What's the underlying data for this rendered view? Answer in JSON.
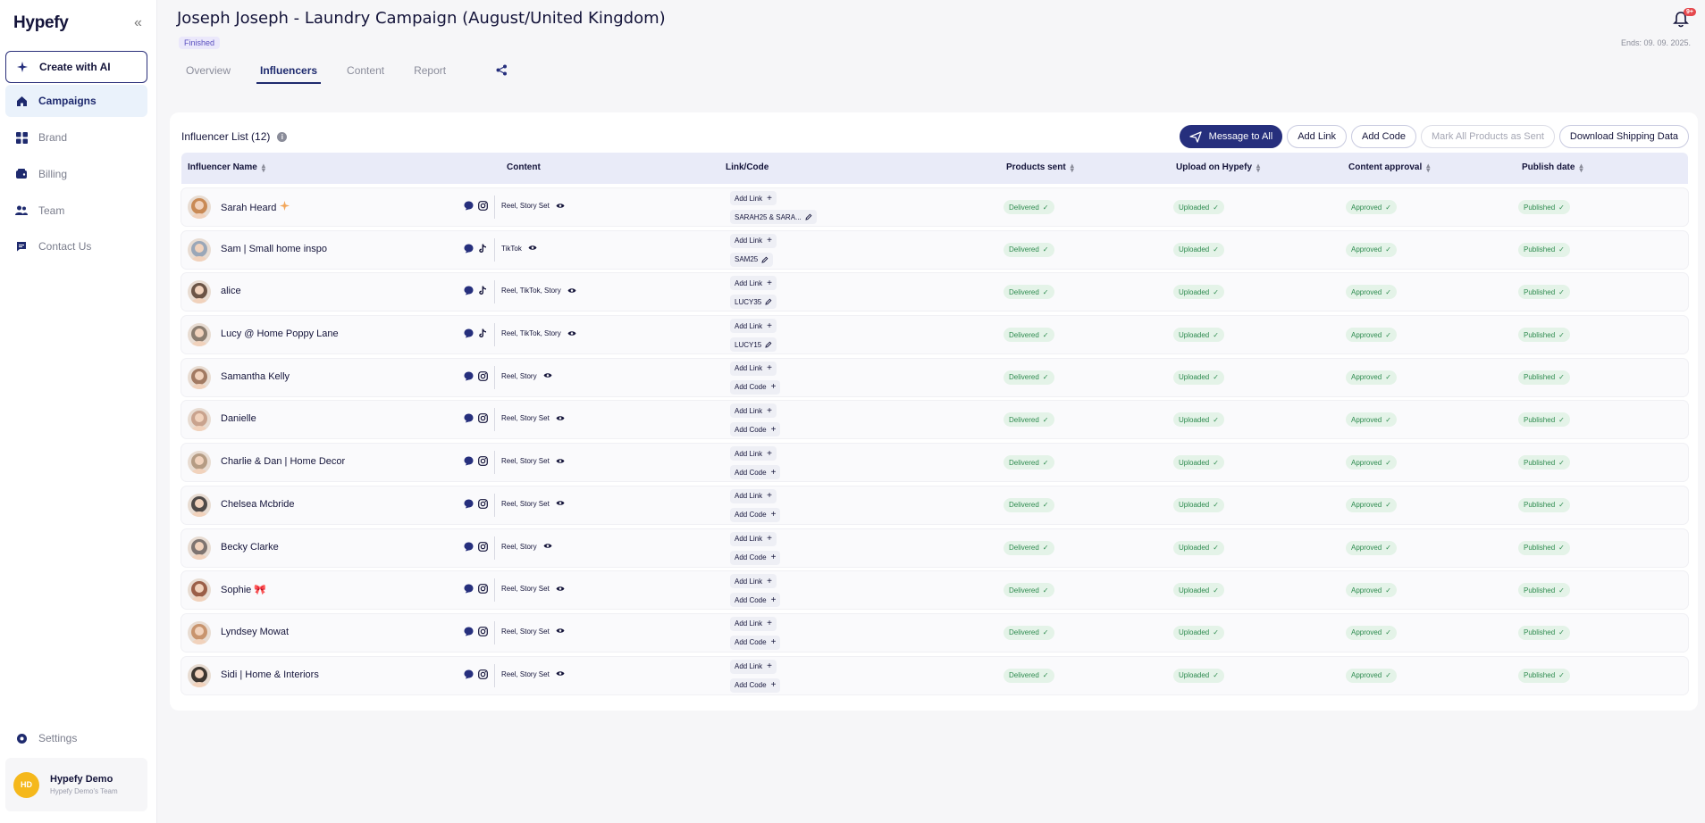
{
  "sidebar": {
    "logo": "Hypefy",
    "collapse_icon": "double-chevron-left-icon",
    "items": [
      {
        "label": "Create with AI",
        "icon": "sparkle-icon"
      },
      {
        "label": "Campaigns",
        "icon": "home-icon"
      },
      {
        "label": "Brand",
        "icon": "grid-icon"
      },
      {
        "label": "Billing",
        "icon": "wallet-icon"
      },
      {
        "label": "Team",
        "icon": "team-icon"
      },
      {
        "label": "Contact Us",
        "icon": "chat-icon"
      }
    ],
    "settings": {
      "label": "Settings",
      "icon": "gear-icon"
    },
    "user": {
      "initials": "HD",
      "name": "Hypefy Demo",
      "team": "Hypefy Demo's Team"
    }
  },
  "header": {
    "title": "Joseph Joseph - Laundry Campaign (August/United Kingdom)",
    "status": "Finished",
    "ends": "Ends: 09. 09. 2025.",
    "notification_badge": "9+",
    "tabs": [
      {
        "label": "Overview"
      },
      {
        "label": "Influencers"
      },
      {
        "label": "Content"
      },
      {
        "label": "Report"
      }
    ]
  },
  "list": {
    "title": "Influencer List (12)",
    "actions": {
      "message_all": "Message to All",
      "add_link": "Add Link",
      "add_code": "Add Code",
      "mark_sent": "Mark All Products as Sent",
      "download": "Download Shipping Data"
    },
    "columns": {
      "name": "Influencer Name",
      "content": "Content",
      "link": "Link/Code",
      "products": "Products sent",
      "upload": "Upload on Hypefy",
      "approval": "Content approval",
      "publish": "Publish date"
    },
    "labels": {
      "add_link": "Add Link",
      "add_code": "Add Code",
      "delivered": "Delivered",
      "uploaded": "Uploaded",
      "approved": "Approved",
      "published": "Published"
    },
    "rows": [
      {
        "name": "Sarah Heard",
        "extra_icon": "sparkle-icon",
        "platform": "instagram-icon",
        "content": "Reel, Story Set",
        "code": "SARAH25 & SARA...",
        "avatar_color": "#c98a55"
      },
      {
        "name": "Sam | Small home inspo",
        "platform": "tiktok-icon",
        "content": "TikTok",
        "code": "SAM25",
        "avatar_color": "#9aa7b8"
      },
      {
        "name": "alice",
        "platform": "tiktok-icon",
        "content": "Reel, TikTok, Story",
        "code": "LUCY35",
        "avatar_color": "#6b5446"
      },
      {
        "name": "Lucy @ Home Poppy Lane",
        "platform": "tiktok-icon",
        "content": "Reel, TikTok, Story",
        "code": "LUCY15",
        "avatar_color": "#8b7d70"
      },
      {
        "name": "Samantha Kelly",
        "platform": "instagram-icon",
        "content": "Reel, Story",
        "code": "",
        "avatar_color": "#a27a62"
      },
      {
        "name": "Danielle",
        "platform": "instagram-icon",
        "content": "Reel, Story Set",
        "code": "",
        "avatar_color": "#c9a38e"
      },
      {
        "name": "Charlie & Dan | Home Decor",
        "platform": "instagram-icon",
        "content": "Reel, Story Set",
        "code": "",
        "avatar_color": "#b59c84"
      },
      {
        "name": "Chelsea Mcbride",
        "platform": "instagram-icon",
        "content": "Reel, Story Set",
        "code": "",
        "avatar_color": "#4f4a48"
      },
      {
        "name": "Becky Clarke",
        "platform": "instagram-icon",
        "content": "Reel, Story",
        "code": "",
        "avatar_color": "#7e7470"
      },
      {
        "name": "Sophie 🎀",
        "platform": "instagram-icon",
        "content": "Reel, Story Set",
        "code": "",
        "avatar_color": "#9b5f48"
      },
      {
        "name": "Lyndsey Mowat",
        "platform": "instagram-icon",
        "content": "Reel, Story Set",
        "code": "",
        "avatar_color": "#c8946e"
      },
      {
        "name": "Sidi | Home & Interiors",
        "platform": "instagram-icon",
        "content": "Reel, Story Set",
        "code": "",
        "avatar_color": "#3d3630"
      }
    ]
  },
  "colors": {
    "accent": "#262f7d",
    "status_green_bg": "#e4f3e8",
    "status_green_text": "#2e8b4f",
    "header_row": "#e9ebf8"
  }
}
